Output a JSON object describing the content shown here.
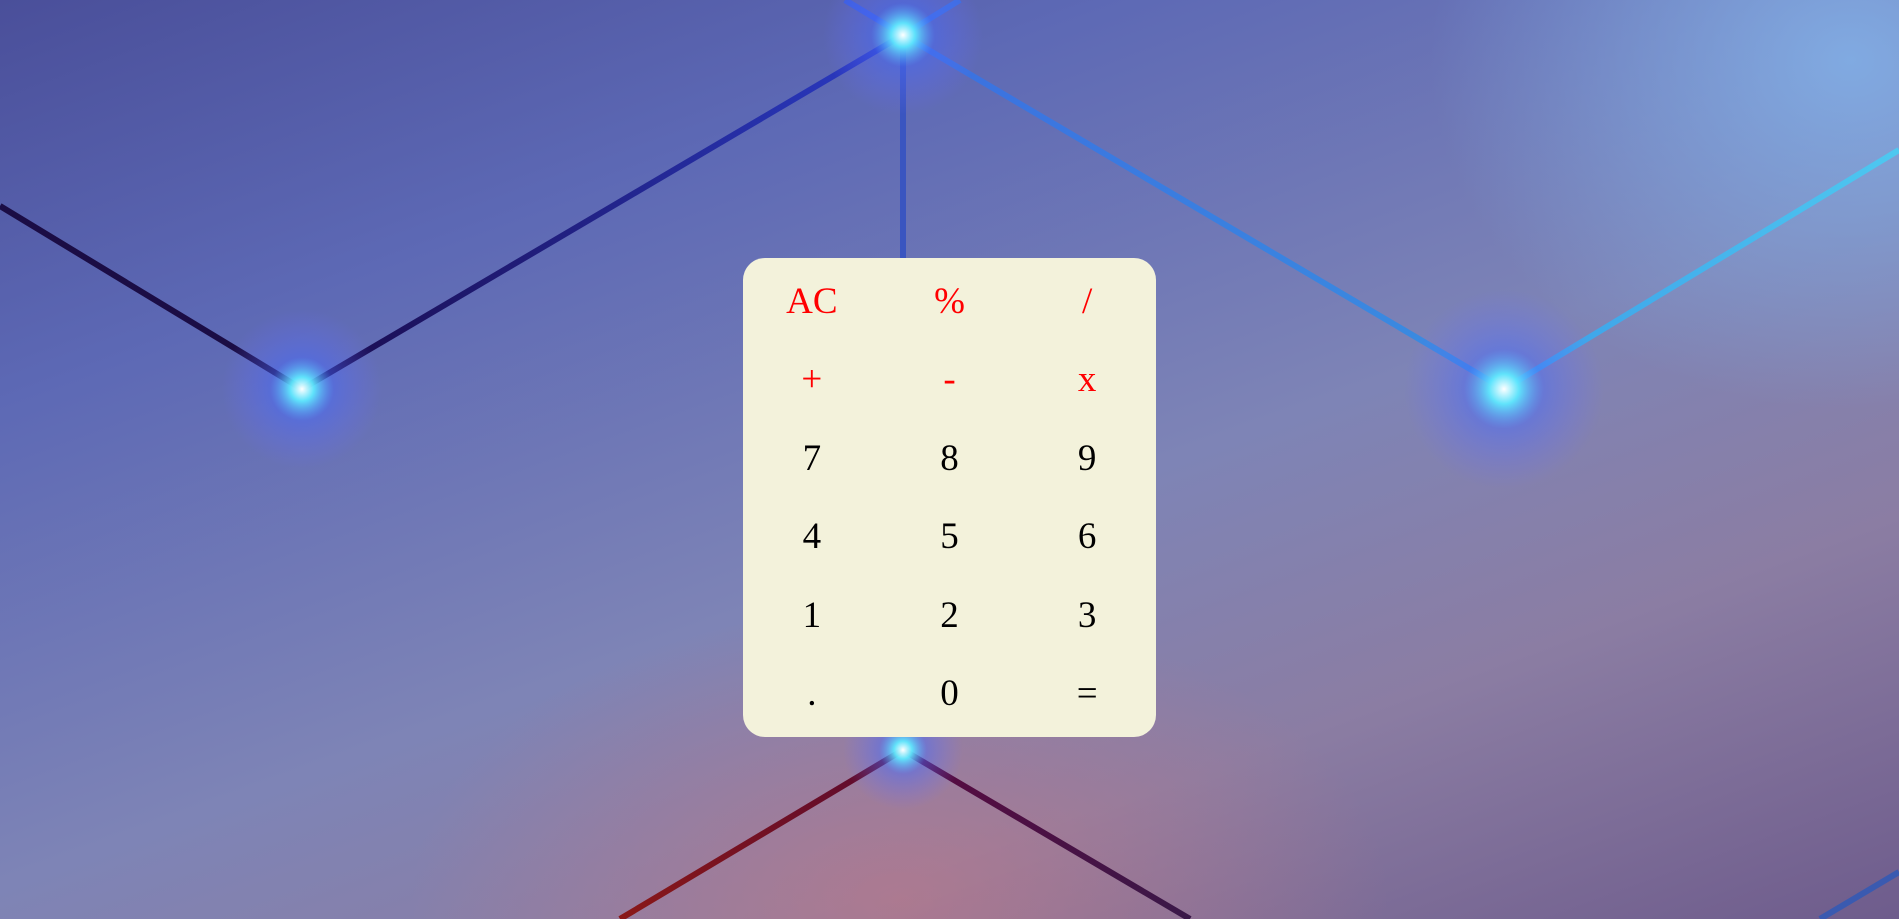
{
  "colors": {
    "panel_background": "#f3f2db",
    "operator_text": "#ff0000",
    "digit_text": "#000000",
    "glow": "#5fe8ff"
  },
  "keypad": {
    "rows": [
      [
        {
          "label": "AC",
          "kind": "operator",
          "name": "all-clear-button"
        },
        {
          "label": "%",
          "kind": "operator",
          "name": "percent-button"
        },
        {
          "label": "/",
          "kind": "operator",
          "name": "divide-button"
        }
      ],
      [
        {
          "label": "+",
          "kind": "operator",
          "name": "add-button"
        },
        {
          "label": "-",
          "kind": "operator",
          "name": "subtract-button"
        },
        {
          "label": "x",
          "kind": "operator",
          "name": "multiply-button"
        }
      ],
      [
        {
          "label": "7",
          "kind": "digit",
          "name": "digit-7-button"
        },
        {
          "label": "8",
          "kind": "digit",
          "name": "digit-8-button"
        },
        {
          "label": "9",
          "kind": "digit",
          "name": "digit-9-button"
        }
      ],
      [
        {
          "label": "4",
          "kind": "digit",
          "name": "digit-4-button"
        },
        {
          "label": "5",
          "kind": "digit",
          "name": "digit-5-button"
        },
        {
          "label": "6",
          "kind": "digit",
          "name": "digit-6-button"
        }
      ],
      [
        {
          "label": "1",
          "kind": "digit",
          "name": "digit-1-button"
        },
        {
          "label": "2",
          "kind": "digit",
          "name": "digit-2-button"
        },
        {
          "label": "3",
          "kind": "digit",
          "name": "digit-3-button"
        }
      ],
      [
        {
          "label": ".",
          "kind": "digit",
          "name": "decimal-point-button"
        },
        {
          "label": "0",
          "kind": "digit",
          "name": "digit-0-button"
        },
        {
          "label": "=",
          "kind": "digit",
          "name": "equals-button"
        }
      ]
    ]
  }
}
